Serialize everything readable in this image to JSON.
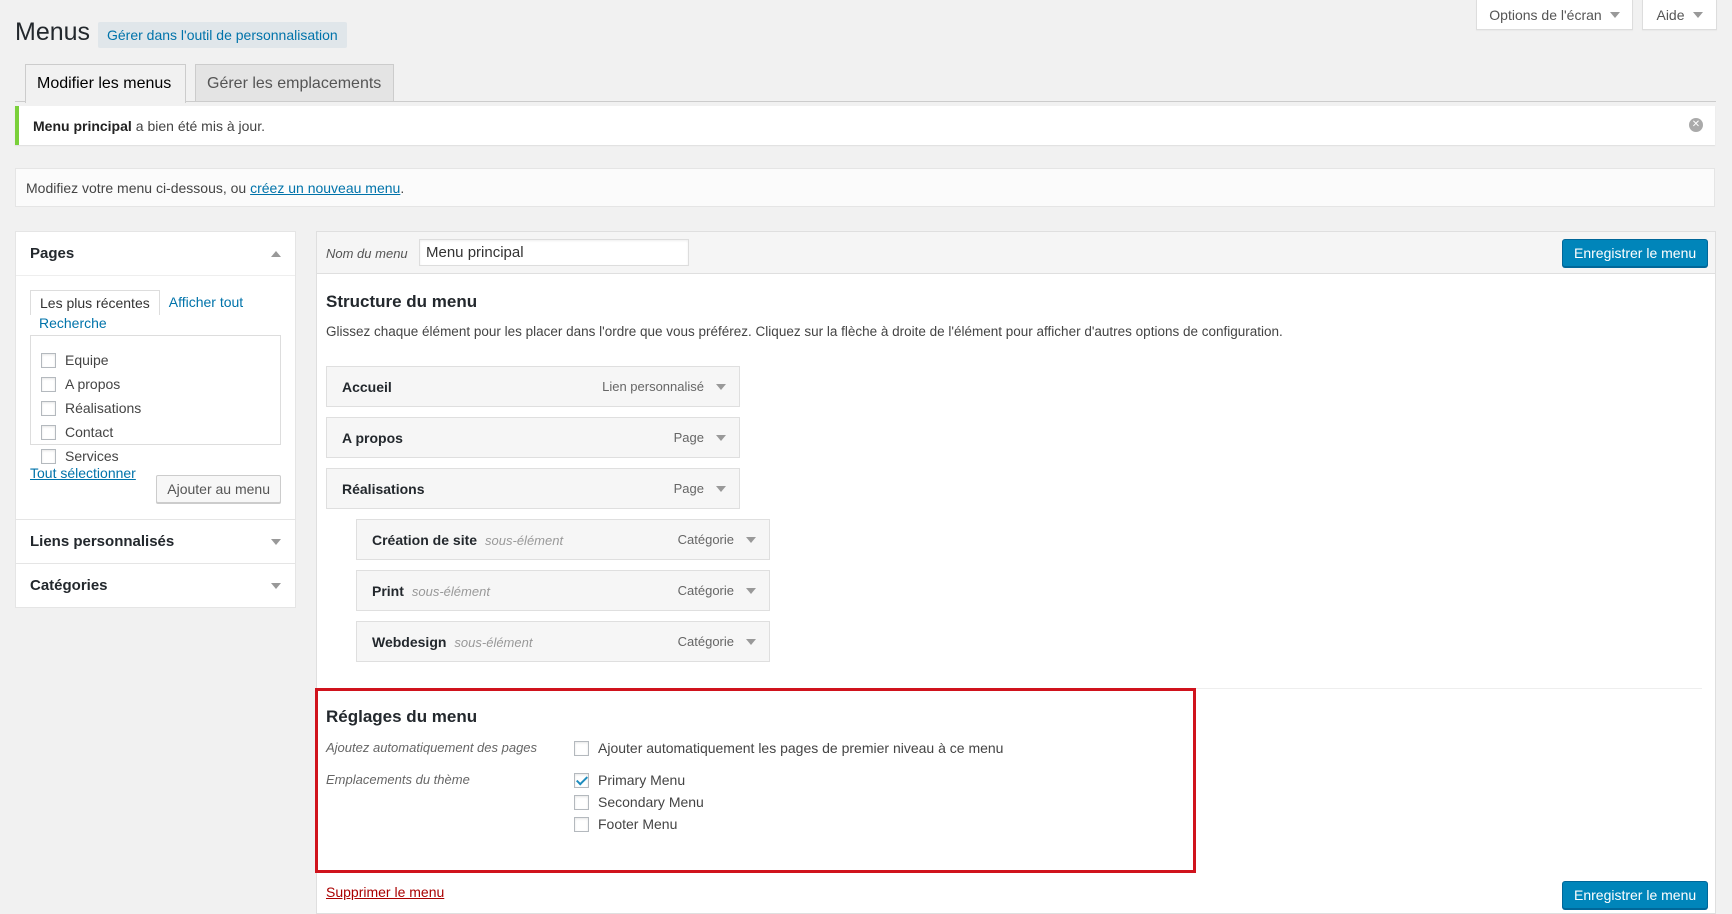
{
  "screen_options": {
    "label": "Options de l'écran"
  },
  "help": {
    "label": "Aide"
  },
  "page": {
    "title": "Menus",
    "customize_label": "Gérer dans l'outil de personnalisation"
  },
  "tabs": [
    {
      "label": "Modifier les menus"
    },
    {
      "label": "Gérer les emplacements"
    }
  ],
  "notice": {
    "bold": "Menu principal",
    "text": "a bien été mis à jour."
  },
  "manage": {
    "text": "Modifiez votre menu ci-dessous, ou",
    "link": "créez un nouveau menu",
    "end": "."
  },
  "sidebar": {
    "pages": {
      "title": "Pages",
      "tabs": [
        "Les plus récentes",
        "Afficher tout",
        "Recherche"
      ],
      "items": [
        "Equipe",
        "A propos",
        "Réalisations",
        "Contact",
        "Services"
      ],
      "select_all": "Tout sélectionner",
      "add_button": "Ajouter au menu"
    },
    "custom_links": {
      "title": "Liens personnalisés"
    },
    "categories": {
      "title": "Catégories"
    }
  },
  "editor": {
    "name_label": "Nom du menu",
    "name_value": "Menu principal",
    "save_label": "Enregistrer le menu",
    "structure_title": "Structure du menu",
    "structure_desc": "Glissez chaque élément pour les placer dans l'ordre que vous préférez. Cliquez sur la flèche à droite de l'élément pour afficher d'autres options de configuration.",
    "items": [
      {
        "title": "Accueil",
        "sub": "",
        "type": "Lien personnalisé"
      },
      {
        "title": "A propos",
        "sub": "",
        "type": "Page"
      },
      {
        "title": "Réalisations",
        "sub": "",
        "type": "Page"
      },
      {
        "title": "Création de site",
        "sub": "sous-élément",
        "type": "Catégorie"
      },
      {
        "title": "Print",
        "sub": "sous-élément",
        "type": "Catégorie"
      },
      {
        "title": "Webdesign",
        "sub": "sous-élément",
        "type": "Catégorie"
      }
    ],
    "settings": {
      "title": "Réglages du menu",
      "auto_add_label": "Ajoutez automatiquement des pages",
      "auto_add_option": "Ajouter automatiquement les pages de premier niveau à ce menu",
      "locations_label": "Emplacements du thème",
      "locations": [
        {
          "label": "Primary Menu",
          "checked": true
        },
        {
          "label": "Secondary Menu",
          "checked": false
        },
        {
          "label": "Footer Menu",
          "checked": false
        }
      ]
    },
    "delete_label": "Supprimer le menu"
  },
  "colors": {
    "accent": "#0085ba",
    "notice_success": "#7ad03a",
    "highlight": "#d0131d",
    "delete": "#aa0000"
  }
}
